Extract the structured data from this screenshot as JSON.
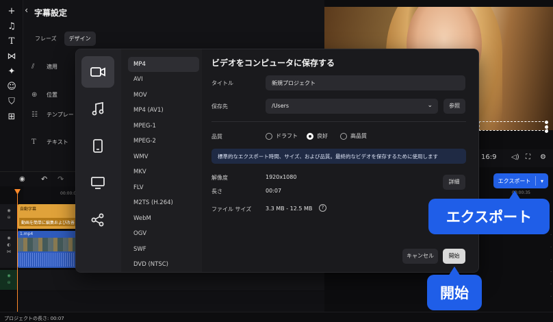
{
  "settings_panel": {
    "title": "字幕設定",
    "tabs": [
      {
        "label": "フレーズ"
      },
      {
        "label": "デザイン"
      }
    ],
    "rows": [
      {
        "label": "適用",
        "icon": "apply-icon"
      },
      {
        "label": "位置",
        "icon": "position-icon"
      },
      {
        "label": "テンプレート",
        "icon": "template-icon"
      },
      {
        "label": "テキスト",
        "icon": "text-icon"
      }
    ]
  },
  "preview": {
    "timecode": "16:9"
  },
  "export_button": {
    "label": "エクスポート"
  },
  "timeline": {
    "ruler": [
      "00:00:05"
    ],
    "ruler_right": "00:00:35",
    "subtitle_clip": {
      "name": "自動字幕",
      "text": "動画を簡単に編集および改善"
    },
    "video_clip": {
      "name": "1.mp4"
    },
    "project_length": "プロジェクトの長さ: 00:07"
  },
  "modal": {
    "title": "ビデオをコンピュータに保存する",
    "categories": [
      {
        "name": "video",
        "icon": "video-camera-icon"
      },
      {
        "name": "audio",
        "icon": "music-note-icon"
      },
      {
        "name": "device",
        "icon": "smartphone-icon"
      },
      {
        "name": "tv",
        "icon": "monitor-icon"
      },
      {
        "name": "share",
        "icon": "share-icon"
      }
    ],
    "formats": [
      "MP4",
      "AVI",
      "MOV",
      "MP4 (AV1)",
      "MPEG-1",
      "MPEG-2",
      "WMV",
      "MKV",
      "FLV",
      "M2TS (H.264)",
      "WebM",
      "OGV",
      "SWF",
      "DVD (NTSC)"
    ],
    "selected_format": "MP4",
    "fields": {
      "title_label": "タイトル",
      "title_value": "新規プロジェクト",
      "save_to_label": "保存先",
      "save_to_value": "/Users",
      "browse_label": "参照"
    },
    "quality": {
      "label": "品質",
      "options": [
        "ドラフト",
        "良好",
        "高品質"
      ],
      "selected": "良好"
    },
    "note": "標準的なエクスポート時間、サイズ、および品質。最終的なビデオを保存するために使用します",
    "resolution_label": "解像度",
    "resolution_value": "1920x1080",
    "length_label": "長さ",
    "length_value": "00:07",
    "filesize_label": "ファイル サイズ",
    "filesize_value": "3.3 MB - 12.5 MB",
    "detail_label": "詳細",
    "cancel_label": "キャンセル",
    "start_label": "開始"
  },
  "callouts": {
    "export": "エクスポート",
    "start": "開始"
  },
  "colors": {
    "accent": "#2361e8",
    "callout": "#1f5ee8",
    "subtitle_clip": "#e0a23a",
    "video_clip": "#2f5bbd",
    "playhead": "#ff8a2a"
  }
}
